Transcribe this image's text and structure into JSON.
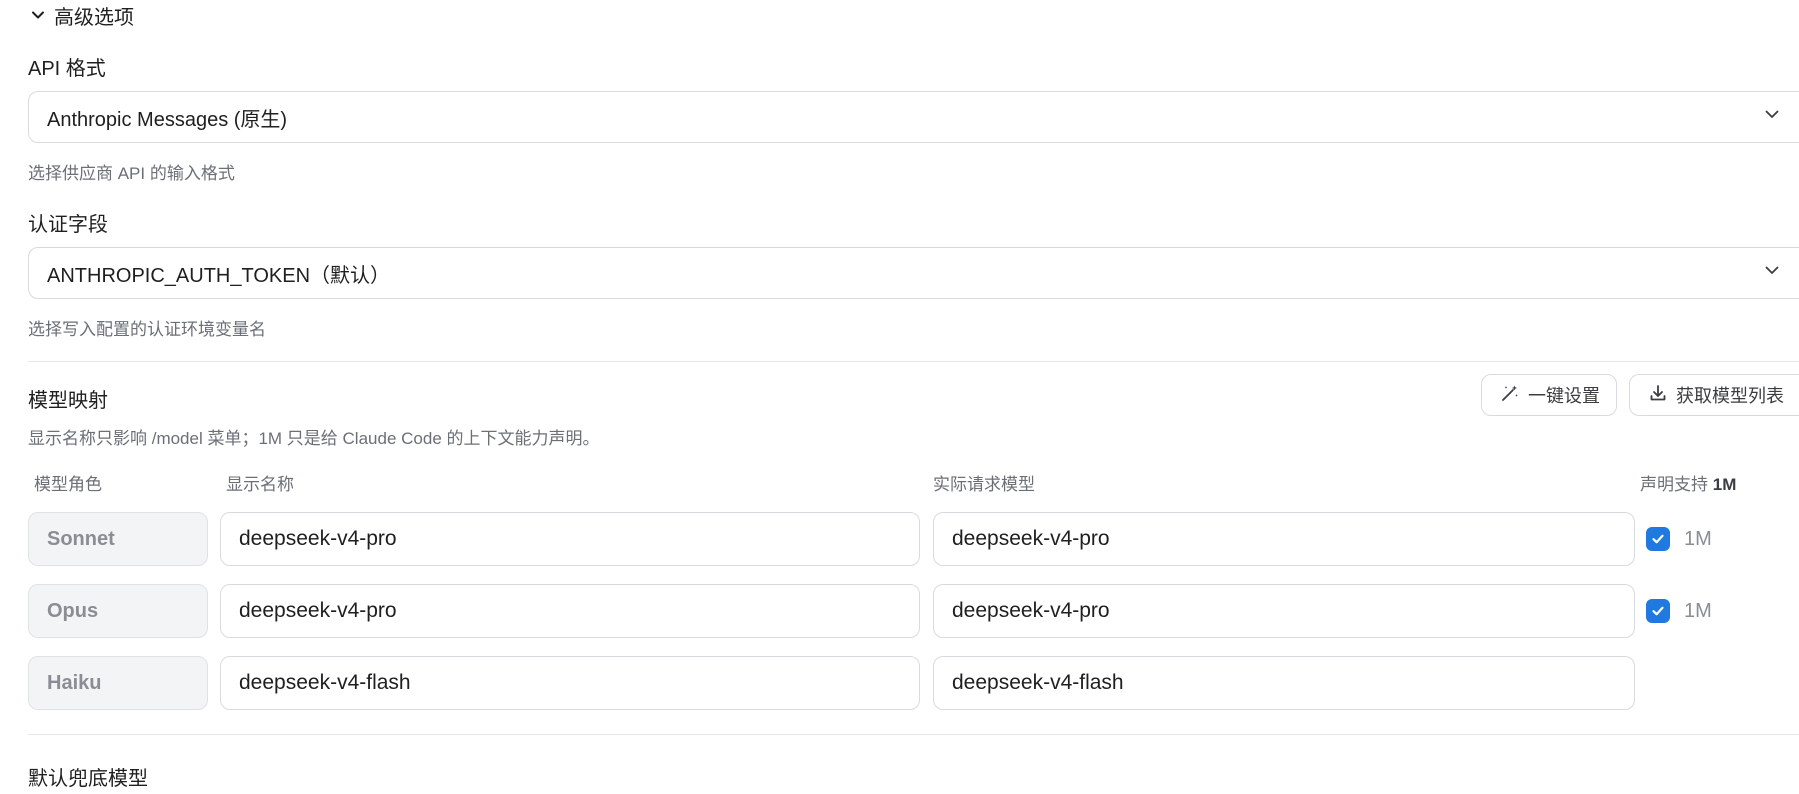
{
  "advanced": {
    "toggle_label": "高级选项"
  },
  "api_format": {
    "label": "API 格式",
    "selected": "Anthropic Messages (原生)",
    "hint": "选择供应商 API 的输入格式"
  },
  "auth_field": {
    "label": "认证字段",
    "selected": "ANTHROPIC_AUTH_TOKEN（默认）",
    "hint": "选择写入配置的认证环境变量名"
  },
  "model_mapping": {
    "title": "模型映射",
    "description": "显示名称只影响 /model 菜单；1M 只是给 Claude Code 的上下文能力声明。",
    "one_click_label": "一键设置",
    "fetch_models_label": "获取模型列表",
    "columns": {
      "role": "模型角色",
      "display_name": "显示名称",
      "actual_model": "实际请求模型",
      "declare_prefix": "声明支持 ",
      "declare_strong": "1M"
    },
    "rows": [
      {
        "role": "Sonnet",
        "display_name": "deepseek-v4-pro",
        "actual_model": "deepseek-v4-pro",
        "has_1m": true,
        "one_m_checked": true,
        "one_m_label": "1M"
      },
      {
        "role": "Opus",
        "display_name": "deepseek-v4-pro",
        "actual_model": "deepseek-v4-pro",
        "has_1m": true,
        "one_m_checked": true,
        "one_m_label": "1M"
      },
      {
        "role": "Haiku",
        "display_name": "deepseek-v4-flash",
        "actual_model": "deepseek-v4-flash",
        "has_1m": false
      }
    ]
  },
  "fallback": {
    "title": "默认兜底模型"
  },
  "icons": {
    "collapse": "chevron-down-icon",
    "select": "chevron-down-icon",
    "one_click": "magic-wand-icon",
    "fetch": "download-icon",
    "check": "checkmark-icon"
  },
  "colors": {
    "accent": "#1f7ae0",
    "border": "#d9dbe0",
    "muted_text": "#6b6f76"
  }
}
